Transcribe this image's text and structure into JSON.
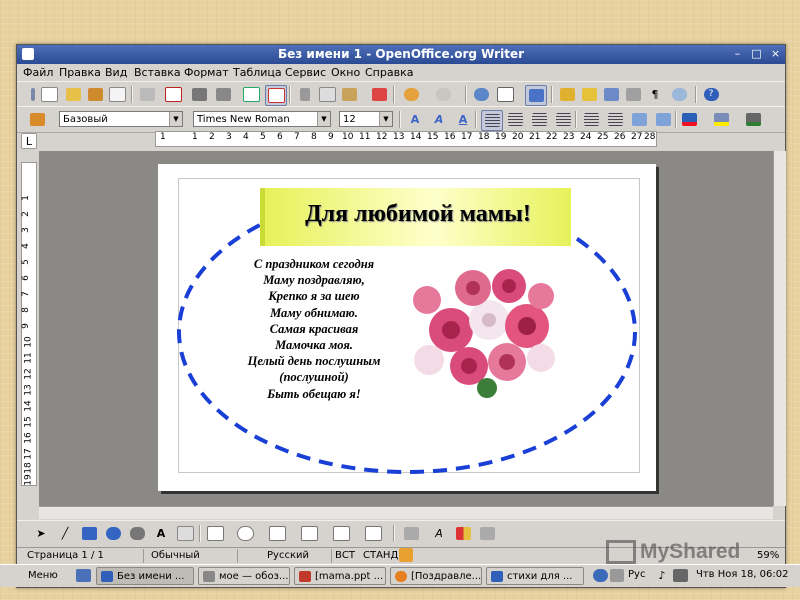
{
  "window": {
    "title": "Без имени 1 - OpenOffice.org Writer"
  },
  "menu": [
    "Файл",
    "Правка",
    "Вид",
    "Вставка",
    "Формат",
    "Таблица",
    "Сервис",
    "Окно",
    "Справка"
  ],
  "format_bar": {
    "style": "Базовый",
    "font": "Times New Roman",
    "size": "12"
  },
  "ruler_h": [
    "1",
    "1",
    "2",
    "3",
    "4",
    "5",
    "6",
    "7",
    "8",
    "9",
    "10",
    "11",
    "12",
    "13",
    "14",
    "15",
    "16",
    "17",
    "18",
    "19",
    "20",
    "21",
    "22",
    "23",
    "24",
    "25",
    "26",
    "27",
    "28"
  ],
  "ruler_v": [
    "1",
    "2",
    "3",
    "4",
    "5",
    "6",
    "7",
    "8",
    "9",
    "10",
    "11",
    "12",
    "13",
    "14",
    "15",
    "16",
    "17",
    "18",
    "19"
  ],
  "document": {
    "heading": "Для любимой мамы!",
    "poem": [
      "С праздником сегодня",
      "Маму поздравляю,",
      "Крепко я за шею",
      "Маму обнимаю.",
      "Самая красивая",
      "Мамочка моя.",
      "Целый день послушным",
      "(послушной)",
      "Быть обещаю я!"
    ]
  },
  "status": {
    "page": "Страница  1 / 1",
    "style": "Обычный",
    "language": "Русский",
    "insert": "ВСТ",
    "mode": "СТАНД",
    "zoom": "59%"
  },
  "taskbar": {
    "start": "Меню",
    "tasks": [
      "Без имени ...",
      "мое — обоз...",
      "[mama.ppt ...",
      "[Поздравле...",
      "стихи для ..."
    ],
    "lang": "Рус",
    "clock": "Чтв Ноя 18, 06:02"
  },
  "watermark": "MyShared",
  "colors": {
    "titlebar": "#2a4a94",
    "banner": "#e6f25a",
    "ellipse": "#1a3fd6"
  }
}
